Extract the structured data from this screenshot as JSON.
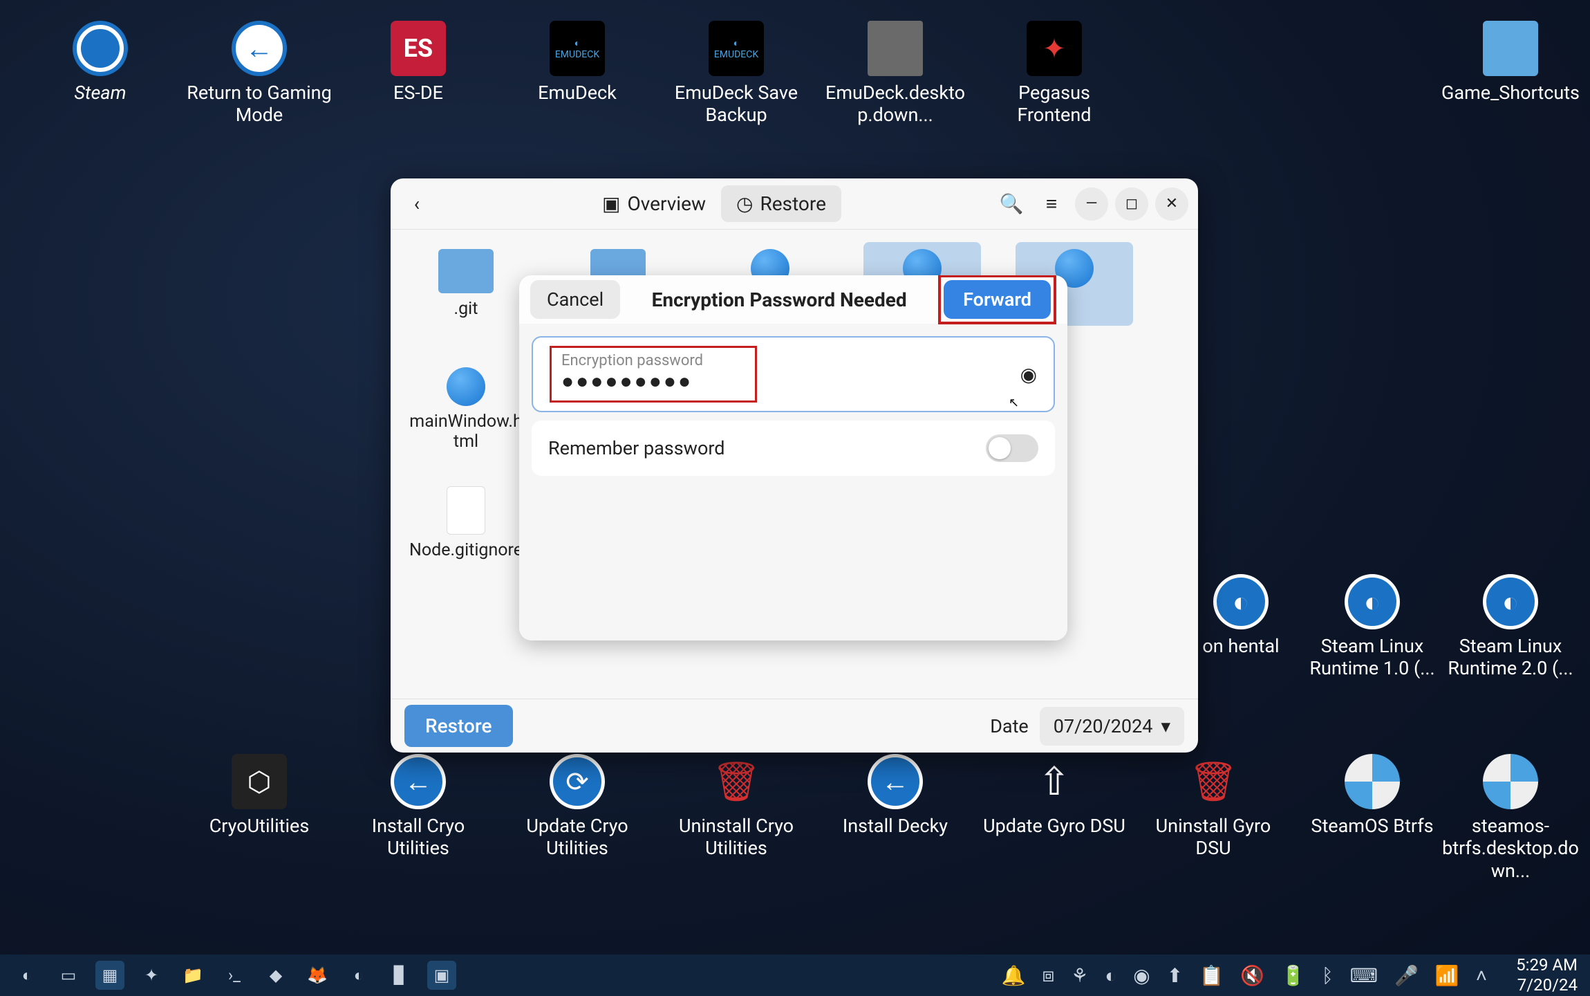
{
  "desktop": {
    "row1": [
      {
        "label": "Steam",
        "italic": true
      },
      {
        "label": "Return to Gaming Mode"
      },
      {
        "label": "ES-DE"
      },
      {
        "label": "EmuDeck"
      },
      {
        "label": "EmuDeck Save Backup"
      },
      {
        "label": "EmuDeck.desktop.down..."
      },
      {
        "label": "Pegasus Frontend"
      },
      {
        "label": "Game_Shortcuts"
      }
    ],
    "row2": [
      {
        "label": "on hental"
      },
      {
        "label": "Steam Linux Runtime 1.0 (..."
      },
      {
        "label": "Steam Linux Runtime 2.0 (..."
      }
    ],
    "row3": [
      {
        "label": "CryoUtilities"
      },
      {
        "label": "Install Cryo Utilities"
      },
      {
        "label": "Update Cryo Utilities"
      },
      {
        "label": "Uninstall Cryo Utilities"
      },
      {
        "label": "Install Decky"
      },
      {
        "label": "Update Gyro DSU"
      },
      {
        "label": "Uninstall Gyro DSU"
      },
      {
        "label": "SteamOS Btrfs"
      },
      {
        "label": "steamos-btrfs.desktop.down..."
      }
    ]
  },
  "window": {
    "tabs": {
      "overview": "Overview",
      "restore": "Restore"
    },
    "files": [
      {
        "label": ".git",
        "type": "folder"
      },
      {
        "label": "",
        "type": "folder"
      },
      {
        "label": "",
        "type": "globe"
      },
      {
        "label": "",
        "type": "globe",
        "sel": true
      },
      {
        "label": "",
        "type": "globe",
        "sel": true
      },
      {
        "label": "mainWindow.html",
        "type": "globe"
      }
    ],
    "file2": {
      "label": "Node.gitignore"
    },
    "footer": {
      "restore": "Restore",
      "date_label": "Date",
      "date_value": "07/20/2024"
    }
  },
  "dialog": {
    "cancel": "Cancel",
    "title": "Encryption Password Needed",
    "forward": "Forward",
    "field_label": "Encryption password",
    "field_value": "●●●●●●●●●",
    "remember": "Remember password"
  },
  "taskbar": {
    "clock_time": "5:29 AM",
    "clock_date": "7/20/24"
  }
}
